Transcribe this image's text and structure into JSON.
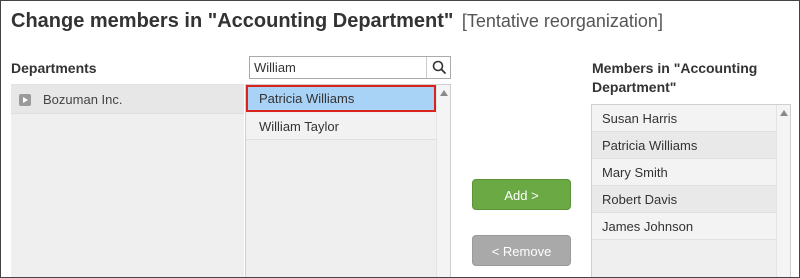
{
  "header": {
    "title": "Change members in \"Accounting Department\"",
    "subtitle": "[Tentative reorganization]"
  },
  "departments": {
    "label": "Departments",
    "items": [
      {
        "name": "Bozuman Inc.",
        "icon": "expand-arrow-icon"
      }
    ]
  },
  "search": {
    "value": "William",
    "icon": "search-icon"
  },
  "users": {
    "items": [
      {
        "name": "Patricia Williams",
        "selected": true
      },
      {
        "name": "William Taylor",
        "selected": false
      }
    ]
  },
  "actions": {
    "add_label": "Add >",
    "remove_label": "< Remove"
  },
  "members": {
    "label": "Members in \"Accounting Department\"",
    "items": [
      "Susan Harris",
      "Patricia Williams",
      "Mary Smith",
      "Robert Davis",
      "James Johnson"
    ]
  },
  "colors": {
    "selected_row": "#a9d2f7",
    "highlight_border": "#d9241e",
    "add_button": "#6aa943",
    "remove_button_disabled": "#a9a9a9"
  }
}
